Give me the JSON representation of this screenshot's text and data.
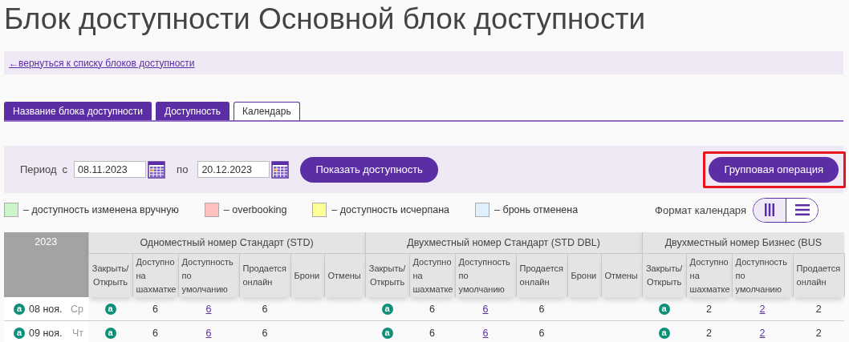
{
  "page_title": "Блок доступности Основной блок доступности",
  "back_link": "←вернуться к списку блоков доступности",
  "tabs": [
    {
      "label": "Название блока доступности",
      "selected": false
    },
    {
      "label": "Доступность",
      "selected": false
    },
    {
      "label": "Календарь",
      "selected": true
    }
  ],
  "filter": {
    "period_label": "Период",
    "from_label": "с",
    "from_value": "08.11.2023",
    "to_label": "по",
    "to_value": "20.12.2023",
    "show_button": "Показать доступность",
    "group_button": "Групповая операция",
    "group_button_highlighted": true
  },
  "legend": [
    {
      "color": "#ccf5cc",
      "label": "– доступность изменена вручную"
    },
    {
      "color": "#ffc0c0",
      "label": "– overbooking"
    },
    {
      "color": "#ffff99",
      "label": "– доступность исчерпана"
    },
    {
      "color": "#e0f0ff",
      "label": "– бронь отменена"
    }
  ],
  "calendar_format": {
    "label": "Формат календаря",
    "options": [
      {
        "kind": "columns",
        "selected": true
      },
      {
        "kind": "rows",
        "selected": false
      }
    ]
  },
  "table": {
    "year": "2023",
    "rooms": [
      {
        "name": "Одноместный номер Стандарт (STD)",
        "columns": [
          "Закрыть/ Открыть",
          "Доступно на шахматке",
          "Доступность по умолчанию",
          "Продается онлайн",
          "Брони",
          "Отмены"
        ]
      },
      {
        "name": "Двухместный номер Стандарт (STD DBL)",
        "columns": [
          "Закрыть/ Открыть",
          "Доступно на шахматке",
          "Доступность по умолчанию",
          "Продается онлайн",
          "Брони",
          "Отмены"
        ]
      },
      {
        "name": "Двухместный номер Бизнес (BUS",
        "columns": [
          "Закрыть/ Открыть",
          "Доступно на шахматке",
          "Доступность по умолчанию",
          "Продается онлайн"
        ]
      }
    ],
    "rows": [
      {
        "date": "08 ноя.",
        "weekday": "Ср",
        "mark": "a",
        "cells": [
          {
            "mark": "a",
            "open": true,
            "chessboard": "6",
            "default": "6",
            "online": "6"
          },
          {
            "mark": "a",
            "open": true,
            "chessboard": "6",
            "default": "6",
            "online": "6"
          },
          {
            "mark": "a",
            "open": true,
            "chessboard": "2",
            "default": "2",
            "online": "2"
          }
        ]
      },
      {
        "date": "09 ноя.",
        "weekday": "Чт",
        "mark": "a",
        "cells": [
          {
            "mark": "a",
            "open": true,
            "chessboard": "6",
            "default": "6",
            "online": "6"
          },
          {
            "mark": "a",
            "open": true,
            "chessboard": "6",
            "default": "6",
            "online": "6"
          },
          {
            "mark": "a",
            "open": true,
            "chessboard": "2",
            "default": "2",
            "online": "2"
          }
        ]
      }
    ]
  }
}
